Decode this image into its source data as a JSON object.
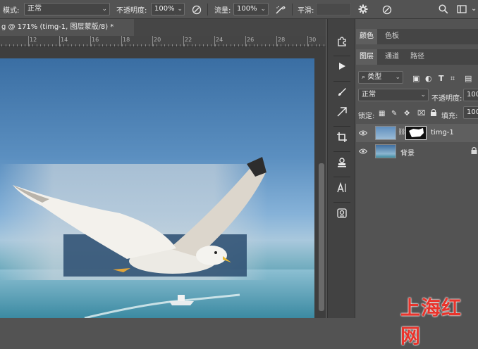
{
  "options_bar": {
    "mode_label": "模式:",
    "mode_value": "正常",
    "opacity_label": "不透明度:",
    "opacity_value": "100%",
    "flow_label": "流量:",
    "flow_value": "100%",
    "smoothing_label": "平滑:"
  },
  "document": {
    "tab_title": "g @ 171% (timg-1, 图层蒙版/8) *",
    "ruler_numbers": [
      "12",
      "14",
      "16",
      "18",
      "20",
      "22",
      "24",
      "26",
      "28",
      "30"
    ]
  },
  "panels": {
    "top_tabs": [
      "颜色",
      "色板"
    ],
    "layer_tabs": [
      "图层",
      "通道",
      "路径"
    ],
    "filter_label": "类型",
    "blend_mode": "正常",
    "opacity_label": "不透明度:",
    "opacity_value": "100",
    "lock_label": "锁定:",
    "fill_label": "填充:",
    "fill_value": "100",
    "layers": [
      {
        "name": "timg-1"
      },
      {
        "name": "背景"
      }
    ]
  },
  "watermark": "上海红网",
  "colors": {
    "app_bg": "#535353",
    "panel_dark": "#424242",
    "watermark": "#e8342c"
  }
}
